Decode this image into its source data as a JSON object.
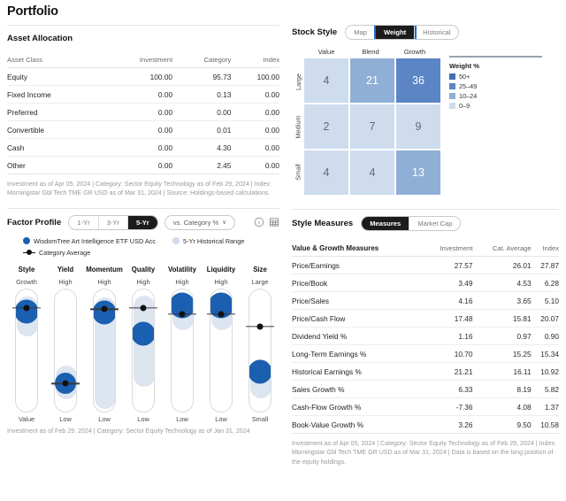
{
  "page": {
    "title": "Portfolio"
  },
  "asset_allocation": {
    "title": "Asset Allocation",
    "columns": [
      "Asset Class",
      "Investment",
      "Category",
      "Index"
    ],
    "rows": [
      {
        "label": "Equity",
        "investment": "100.00",
        "category": "95.73",
        "index": "100.00"
      },
      {
        "label": "Fixed Income",
        "investment": "0.00",
        "category": "0.13",
        "index": "0.00"
      },
      {
        "label": "Preferred",
        "investment": "0.00",
        "category": "0.00",
        "index": "0.00"
      },
      {
        "label": "Convertible",
        "investment": "0.00",
        "category": "0.01",
        "index": "0.00"
      },
      {
        "label": "Cash",
        "investment": "0.00",
        "category": "4.30",
        "index": "0.00"
      },
      {
        "label": "Other",
        "investment": "0.00",
        "category": "2.45",
        "index": "0.00"
      }
    ],
    "footnote": "Investment as of Apr 05, 2024 | Category: Sector Equity Technology as of Feb 29, 2024 | Index: Morningstar Gbl Tech TME GR USD as of Mar 31, 2024 | Source: Holdings-based calculations."
  },
  "stock_style": {
    "title": "Stock Style",
    "tabs": [
      {
        "label": "Map",
        "active": false
      },
      {
        "label": "Weight",
        "active": true
      },
      {
        "label": "Historical",
        "active": false
      }
    ],
    "col_labels": [
      "Value",
      "Blend",
      "Growth"
    ],
    "row_labels": [
      "Large",
      "Medium",
      "Small"
    ],
    "cells": [
      [
        {
          "value": "4",
          "color": "#cedcee",
          "dark": false
        },
        {
          "value": "21",
          "color": "#8fafd6",
          "dark": true
        },
        {
          "value": "36",
          "color": "#5b85c4",
          "dark": true
        }
      ],
      [
        {
          "value": "2",
          "color": "#cedcee",
          "dark": false
        },
        {
          "value": "7",
          "color": "#cedcee",
          "dark": false
        },
        {
          "value": "9",
          "color": "#cedcee",
          "dark": false
        }
      ],
      [
        {
          "value": "4",
          "color": "#cedcee",
          "dark": false
        },
        {
          "value": "4",
          "color": "#cedcee",
          "dark": false
        },
        {
          "value": "13",
          "color": "#8fafd6",
          "dark": true
        }
      ]
    ],
    "legend": {
      "title": "Weight %",
      "items": [
        {
          "label": "50+",
          "color": "#3f6fb5"
        },
        {
          "label": "25–49",
          "color": "#5b85c4"
        },
        {
          "label": "10–24",
          "color": "#8fafd6"
        },
        {
          "label": "0–9",
          "color": "#cedcee"
        }
      ]
    }
  },
  "style_measures": {
    "title": "Style Measures",
    "tabs": [
      {
        "label": "Measures",
        "active": true
      },
      {
        "label": "Market Cap",
        "active": false
      }
    ],
    "columns": [
      "Value & Growth Measures",
      "Investment",
      "Cat. Average",
      "Index"
    ],
    "rows": [
      {
        "label": "Price/Earnings",
        "investment": "27.57",
        "cat_average": "26.01",
        "index": "27.87"
      },
      {
        "label": "Price/Book",
        "investment": "3.49",
        "cat_average": "4.53",
        "index": "6.28"
      },
      {
        "label": "Price/Sales",
        "investment": "4.16",
        "cat_average": "3.65",
        "index": "5.10"
      },
      {
        "label": "Price/Cash Flow",
        "investment": "17.48",
        "cat_average": "15.81",
        "index": "20.07"
      },
      {
        "label": "Dividend Yield %",
        "investment": "1.16",
        "cat_average": "0.97",
        "index": "0.90"
      },
      {
        "label": "Long-Term Earnings %",
        "investment": "10.70",
        "cat_average": "15.25",
        "index": "15.34"
      },
      {
        "label": "Historical Earnings %",
        "investment": "21.21",
        "cat_average": "16.11",
        "index": "10.92"
      },
      {
        "label": "Sales Growth %",
        "investment": "6.33",
        "cat_average": "8.19",
        "index": "5.82"
      },
      {
        "label": "Cash-Flow Growth %",
        "investment": "-7.36",
        "cat_average": "4.08",
        "index": "1.37"
      },
      {
        "label": "Book-Value Growth %",
        "investment": "3.26",
        "cat_average": "9.50",
        "index": "10.58"
      }
    ],
    "footnote": "Investment as of Apr 05, 2024 | Category: Sector Equity Technology as of Feb 29, 2024 | Index: Morningstar Gbl Tech TME GR USD as of Mar 31, 2024 | Data is based on the long position of the equity holdings."
  },
  "factor_profile": {
    "title": "Factor Profile",
    "tabs": [
      {
        "label": "1-Yr",
        "active": false
      },
      {
        "label": "3-Yr",
        "active": false
      },
      {
        "label": "5-Yr",
        "active": true
      }
    ],
    "compare_selector": "vs. Category %",
    "chevron": "∨",
    "icons": [
      "info-icon",
      "table-view-icon"
    ],
    "legend": [
      {
        "label": "WisdomTree Art Intelligence ETF USD Acc",
        "glyph": "investment-dot"
      },
      {
        "label": "5-Yr Historical Range",
        "glyph": "range-dot"
      },
      {
        "label": "Category Average",
        "glyph": "category-average-marker"
      }
    ],
    "columns": [
      {
        "name": "Style",
        "top": "Growth",
        "bottom": "Value",
        "bubble_pct": 18,
        "bubble_size": 27,
        "range_top_pct": 6,
        "range_bottom_pct": 38,
        "avg_pct": 16
      },
      {
        "name": "Yield",
        "top": "High",
        "bottom": "Low",
        "bubble_pct": 76,
        "bubble_size": 24,
        "range_top_pct": 62,
        "range_bottom_pct": 89,
        "avg_pct": 77
      },
      {
        "name": "Momentum",
        "top": "High",
        "bottom": "Low",
        "bubble_pct": 19,
        "bubble_size": 27,
        "range_top_pct": 7,
        "range_bottom_pct": 97,
        "avg_pct": 17
      },
      {
        "name": "Quality",
        "top": "High",
        "bottom": "Low",
        "bubble_pct": 36,
        "bubble_size": 27,
        "range_top_pct": 5,
        "range_bottom_pct": 79,
        "avg_pct": 16
      },
      {
        "name": "Volatility",
        "top": "High",
        "bottom": "Low",
        "bubble_pct": 13,
        "bubble_size": 29,
        "range_top_pct": 3,
        "range_bottom_pct": 33,
        "avg_pct": 21
      },
      {
        "name": "Liquidity",
        "top": "High",
        "bottom": "Low",
        "bubble_pct": 13,
        "bubble_size": 29,
        "range_top_pct": 3,
        "range_bottom_pct": 33,
        "avg_pct": 21
      },
      {
        "name": "Size",
        "top": "Large",
        "bottom": "Small",
        "bubble_pct": 67,
        "bubble_size": 27,
        "range_top_pct": 57,
        "range_bottom_pct": 88,
        "avg_pct": 31
      }
    ],
    "footnote": "Investment as of Feb 29, 2024 | Category: Sector Equity Technology as of Jan 31, 2024"
  }
}
